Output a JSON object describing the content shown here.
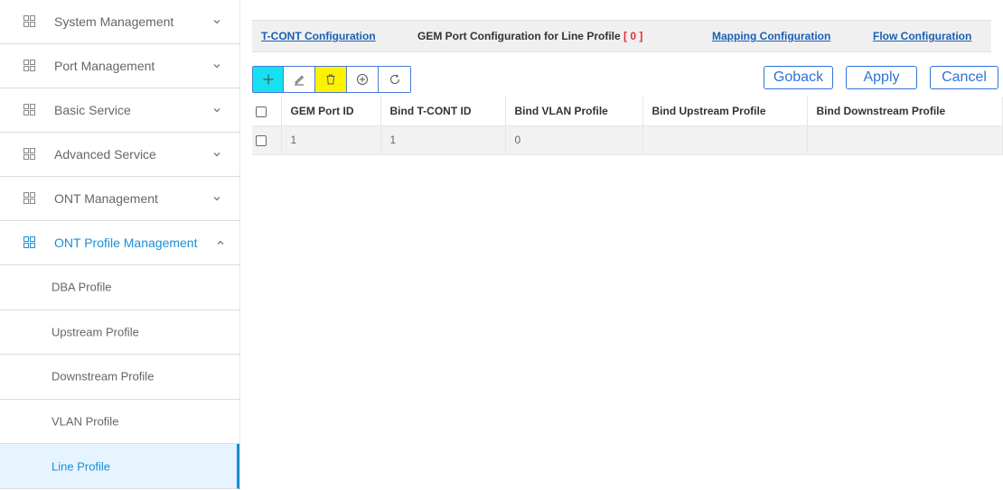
{
  "sidebar": {
    "menus": [
      {
        "label": "System Management",
        "icon": "grid-icon",
        "chevron": "down"
      },
      {
        "label": "Port Management",
        "icon": "grid-icon",
        "chevron": "down"
      },
      {
        "label": "Basic Service",
        "icon": "grid-icon",
        "chevron": "down"
      },
      {
        "label": "Advanced Service",
        "icon": "grid-icon",
        "chevron": "down"
      },
      {
        "label": "ONT Management",
        "icon": "grid-icon",
        "chevron": "down"
      },
      {
        "label": "ONT Profile Management",
        "icon": "grid-icon",
        "chevron": "up",
        "active": true
      }
    ],
    "sub_items": [
      {
        "label": "DBA Profile"
      },
      {
        "label": "Upstream Profile"
      },
      {
        "label": "Downstream Profile"
      },
      {
        "label": "VLAN Profile"
      },
      {
        "label": "Line Profile",
        "selected": true
      }
    ]
  },
  "tabs": {
    "tcont": "T-CONT Configuration",
    "gem_prefix": "GEM Port Configuration for Line Profile ",
    "gem_bracket": "[ 0 ]",
    "mapping": "Mapping Configuration",
    "flow": "Flow Configuration"
  },
  "toolbar": {
    "icons": [
      "plus-icon",
      "edit-icon",
      "trash-icon",
      "circle-plus-icon",
      "refresh-icon"
    ]
  },
  "actions": {
    "goback": "Goback",
    "apply": "Apply",
    "cancel": "Cancel"
  },
  "table": {
    "columns": [
      "GEM Port ID",
      "Bind T-CONT ID",
      "Bind VLAN Profile",
      "Bind Upstream Profile",
      "Bind Downstream Profile"
    ],
    "rows": [
      [
        "1",
        "1",
        "0",
        "",
        ""
      ]
    ]
  },
  "colors": {
    "accent": "#1890d6",
    "link": "#1a5fb4",
    "add_button": "#17e0f0",
    "delete_button": "#fff200",
    "bracket": "#e0303a"
  }
}
